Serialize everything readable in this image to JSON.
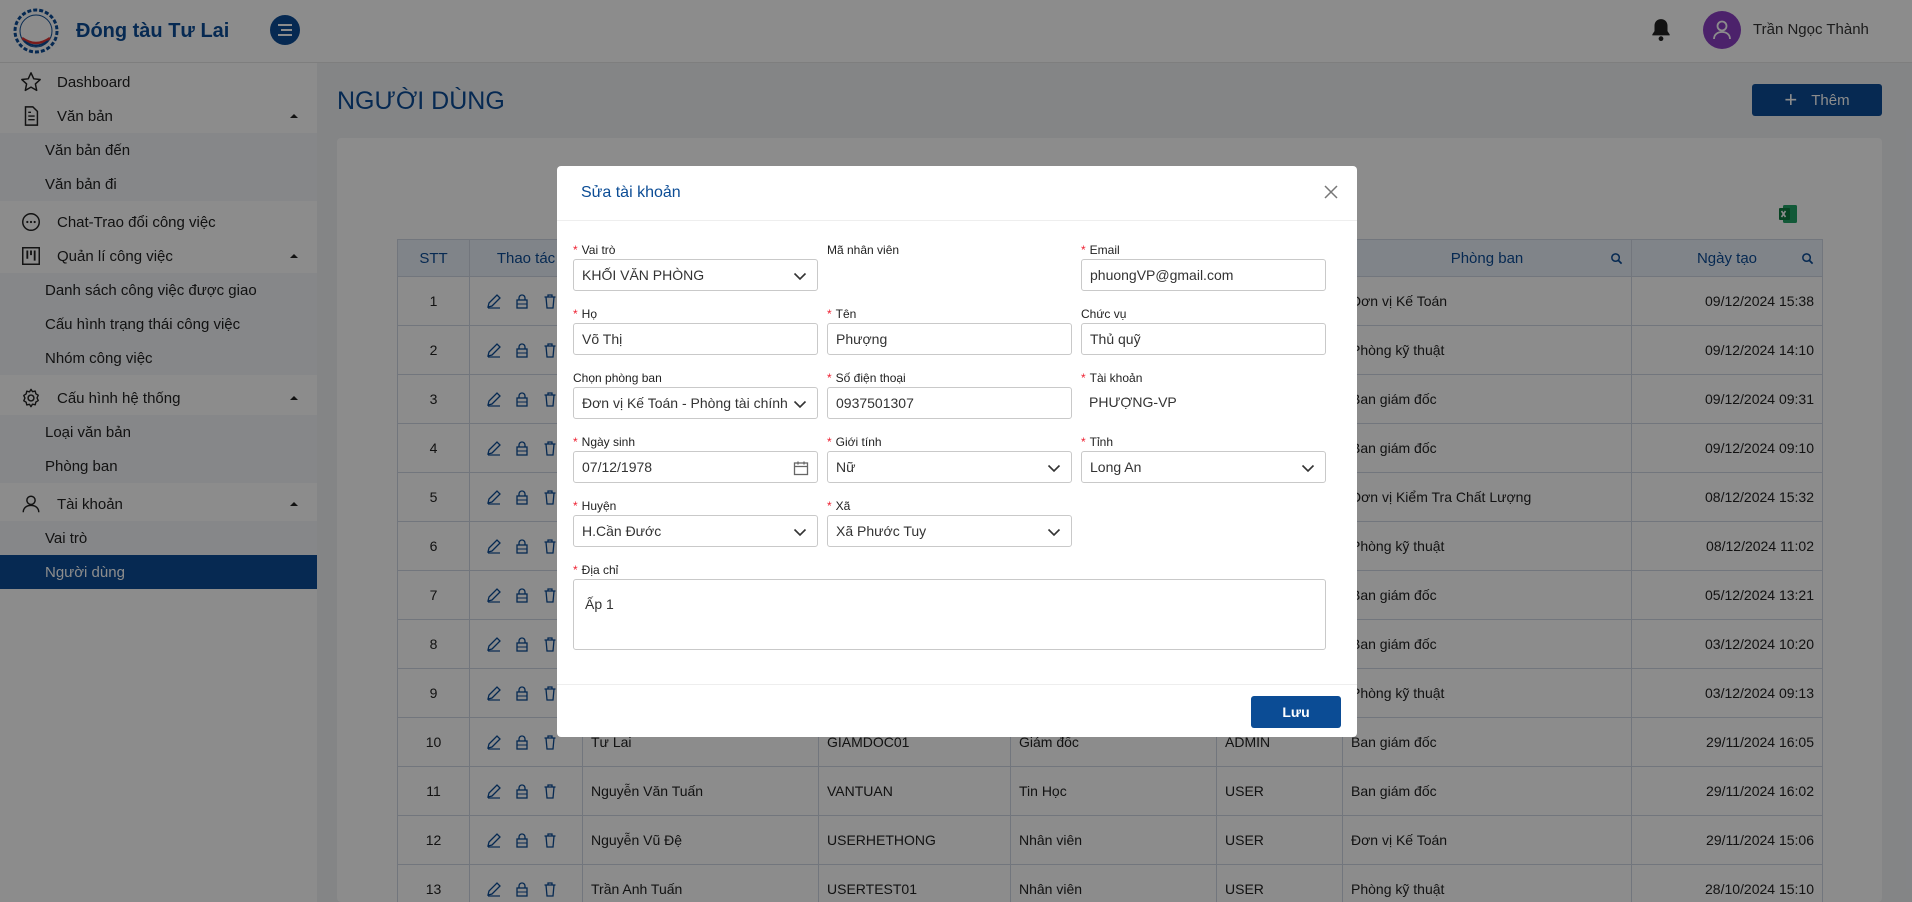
{
  "app": {
    "name": "Đóng tàu Tư Lai",
    "logo_text": "Tư Lai shipyard"
  },
  "header": {
    "user_name": "Trần Ngọc Thành"
  },
  "sidebar": {
    "dashboard": "Dashboard",
    "van_ban": "Văn bản",
    "van_ban_den": "Văn bản đến",
    "van_ban_di": "Văn bản đi",
    "chat": "Chat-Trao đổi công việc",
    "quan_li": "Quản lí công việc",
    "danh_sach": "Danh sách công việc được giao",
    "cau_hinh_trang_thai": "Cấu hình trạng thái công việc",
    "nhom_cong_viec": "Nhóm công việc",
    "cau_hinh_he_thong": "Cấu hình hệ thống",
    "loai_van_ban": "Loại văn bản",
    "phong_ban": "Phòng ban",
    "tai_khoan": "Tài khoản",
    "vai_tro": "Vai trò",
    "nguoi_dung": "Người dùng"
  },
  "page": {
    "title": "NGƯỜI DÙNG",
    "add_label": "Thêm"
  },
  "table": {
    "headers": {
      "stt": "STT",
      "actions": "Thao tác",
      "department": "Phòng ban",
      "created": "Ngày tạo"
    },
    "rows": [
      {
        "stt": "1",
        "name": "",
        "code": "",
        "position": "",
        "role": "",
        "dept": "Đơn vị Kế Toán",
        "date": "09/12/2024 15:38"
      },
      {
        "stt": "2",
        "name": "",
        "code": "",
        "position": "",
        "role": "",
        "dept": "Phòng kỹ thuật",
        "date": "09/12/2024 14:10"
      },
      {
        "stt": "3",
        "name": "",
        "code": "",
        "position": "",
        "role": "",
        "dept": "Ban giám đốc",
        "date": "09/12/2024 09:31"
      },
      {
        "stt": "4",
        "name": "",
        "code": "",
        "position": "",
        "role": "",
        "dept": "Ban giám đốc",
        "date": "09/12/2024 09:10"
      },
      {
        "stt": "5",
        "name": "",
        "code": "",
        "position": "",
        "role": "",
        "dept": "Đơn vị Kiểm Tra Chất Lượng",
        "date": "08/12/2024 15:32"
      },
      {
        "stt": "6",
        "name": "",
        "code": "",
        "position": "",
        "role": "",
        "dept": "Phòng kỹ thuật",
        "date": "08/12/2024 11:02"
      },
      {
        "stt": "7",
        "name": "",
        "code": "",
        "position": "",
        "role": "",
        "dept": "Ban giám đốc",
        "date": "05/12/2024 13:21"
      },
      {
        "stt": "8",
        "name": "",
        "code": "",
        "position": "",
        "role": "",
        "dept": "Ban giám đốc",
        "date": "03/12/2024 10:20"
      },
      {
        "stt": "9",
        "name": "",
        "code": "",
        "position": "",
        "role": "",
        "dept": "Phòng kỹ thuật",
        "date": "03/12/2024 09:13"
      },
      {
        "stt": "10",
        "name": "Tư Lai",
        "code": "GIAMDOC01",
        "position": "Giám đốc",
        "role": "ADMIN",
        "dept": "Ban giám đốc",
        "date": "29/11/2024 16:05"
      },
      {
        "stt": "11",
        "name": "Nguyễn Văn Tuấn",
        "code": "VANTUAN",
        "position": "Tin Học",
        "role": "USER",
        "dept": "Ban giám đốc",
        "date": "29/11/2024 16:02"
      },
      {
        "stt": "12",
        "name": "Nguyễn Vũ Đệ",
        "code": "USERHETHONG",
        "position": "Nhân viên",
        "role": "USER",
        "dept": "Đơn vị Kế Toán",
        "date": "29/11/2024 15:06"
      },
      {
        "stt": "13",
        "name": "Trần Anh Tuấn",
        "code": "USERTEST01",
        "position": "Nhân viên",
        "role": "USER",
        "dept": "Phòng kỹ thuật",
        "date": "28/10/2024 15:10"
      }
    ]
  },
  "modal": {
    "title": "Sửa tài khoản",
    "fields": {
      "vai_tro": {
        "label": "Vai trò",
        "value": "KHỐI VĂN PHÒNG"
      },
      "ma_nhan_vien": {
        "label": "Mã nhân viên"
      },
      "email": {
        "label": "Email",
        "value": "phuongVP@gmail.com"
      },
      "ho": {
        "label": "Họ",
        "value": "Võ Thị"
      },
      "ten": {
        "label": "Tên",
        "value": "Phượng"
      },
      "chuc_vu": {
        "label": "Chức vụ",
        "value": "Thủ quỹ"
      },
      "phong_ban": {
        "label": "Chọn phòng ban",
        "value": "Đơn vị Kế Toán - Phòng tài chính"
      },
      "sdt": {
        "label": "Số điện thoại",
        "value": "0937501307"
      },
      "tai_khoan": {
        "label": "Tài khoản",
        "value": "PHƯỢNG-VP"
      },
      "ngay_sinh": {
        "label": "Ngày sinh",
        "value": "07/12/1978"
      },
      "gioi_tinh": {
        "label": "Giới tính",
        "value": "Nữ"
      },
      "tinh": {
        "label": "Tỉnh",
        "value": "Long An"
      },
      "huyen": {
        "label": "Huyện",
        "value": "H.Cần Đước"
      },
      "xa": {
        "label": "Xã",
        "value": "Xã Phước Tuy"
      },
      "dia_chi": {
        "label": "Địa chỉ",
        "value": "Ấp 1"
      }
    },
    "save_label": "Lưu"
  },
  "colors": {
    "primary": "#0b4c95",
    "avatar": "#8a3fc4",
    "required": "#e23333"
  }
}
